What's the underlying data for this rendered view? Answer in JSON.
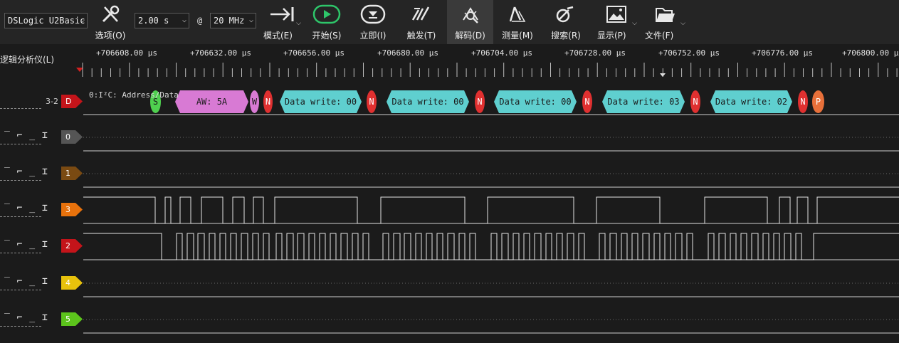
{
  "toolbar": {
    "device": "DSLogic U2Basic",
    "duration": "2.00 s",
    "at": "@",
    "rate": "20 MHz",
    "buttons": {
      "options": "选项(O)",
      "mode": "模式(E)",
      "start": "开始(S)",
      "instant": "立即(I)",
      "trigger": "触发(T)",
      "decode": "解码(D)",
      "measure": "测量(M)",
      "search": "搜索(R)",
      "display": "显示(P)",
      "file": "文件(F)"
    }
  },
  "ruler": {
    "title": "逻辑分析仪(L)",
    "labels": [
      "+706608.00 μs",
      "+706632.00 μs",
      "+706656.00 μs",
      "+706680.00 μs",
      "+706704.00 μs",
      "+706728.00 μs",
      "+706752.00 μs",
      "+706776.00 μs",
      "+706800.00 μs"
    ]
  },
  "decoder": {
    "channel_label": "3-2",
    "tag": "D",
    "name": "0:I²C: Address/Data",
    "annotations": [
      "S",
      "AW: 5A",
      "W",
      "N",
      "Data write: 00",
      "N",
      "Data write: 00",
      "N",
      "Data write: 00",
      "N",
      "Data write: 03",
      "N",
      "Data write: 02",
      "N",
      "P"
    ]
  },
  "channels": [
    {
      "num": "0",
      "color": "#555555"
    },
    {
      "num": "1",
      "color": "#7a4a12"
    },
    {
      "num": "3",
      "color": "#e8720c"
    },
    {
      "num": "2",
      "color": "#c4141a"
    },
    {
      "num": "4",
      "color": "#e8c20c"
    },
    {
      "num": "5",
      "color": "#5cc41c"
    }
  ],
  "trigger_glyphs": "‾ ⌐ _ ⌶",
  "colors": {
    "start": "#4fd04f",
    "address": "#d87ad4",
    "nack": "#e03030",
    "data": "#5fcfcf",
    "stop": "#e8703a"
  }
}
